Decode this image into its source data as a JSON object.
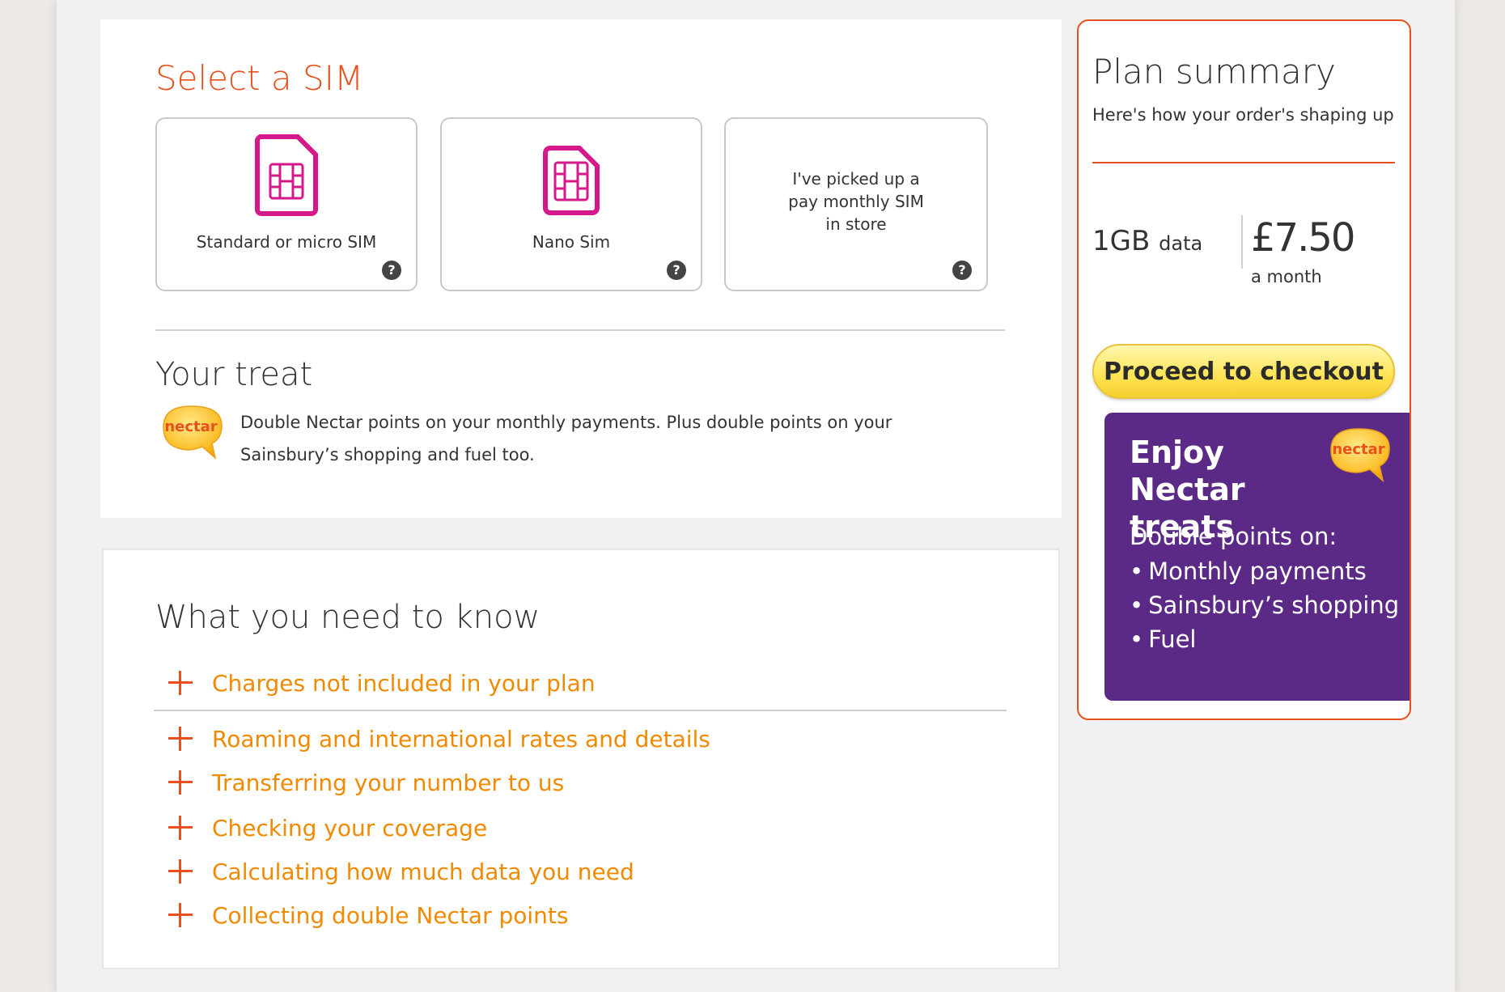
{
  "sim_section": {
    "title": "Select a SIM",
    "options": [
      {
        "label": "Standard or micro SIM"
      },
      {
        "label": "Nano Sim"
      },
      {
        "label": "I've picked up a pay monthly SIM in store"
      }
    ]
  },
  "treat_section": {
    "title": "Your treat",
    "logo_text": "nectar",
    "description": "Double Nectar points on your monthly payments. Plus double points on your Sainsbury’s shopping and fuel too."
  },
  "know_section": {
    "title": "What you need to know",
    "items": [
      {
        "label": "Charges not included in your plan"
      },
      {
        "label": "Roaming and international rates and details"
      },
      {
        "label": "Transferring your number to us"
      },
      {
        "label": "Checking your coverage"
      },
      {
        "label": "Calculating how much data you need"
      },
      {
        "label": "Collecting double Nectar points"
      }
    ]
  },
  "summary": {
    "title": "Plan summary",
    "subtitle": "Here's how your order's shaping up",
    "data_amount": "1GB",
    "data_unit": "data",
    "price": "£7.50",
    "period": "a month",
    "checkout_label": "Proceed to checkout"
  },
  "promo": {
    "heading": "Enjoy Nectar treats",
    "logo_text": "nectar",
    "intro": "Double points on:",
    "bullets": [
      "Monthly payments",
      "Sainsbury’s shopping",
      "Fuel"
    ]
  },
  "colors": {
    "accent_orange": "#e8501e",
    "link_orange": "#f08a00",
    "sim_magenta": "#d6198a",
    "promo_purple": "#5b2a86",
    "button_yellow": "#ffe55a"
  },
  "icons": [
    "sim-card-icon",
    "help-icon",
    "plus-icon",
    "nectar-logo"
  ]
}
